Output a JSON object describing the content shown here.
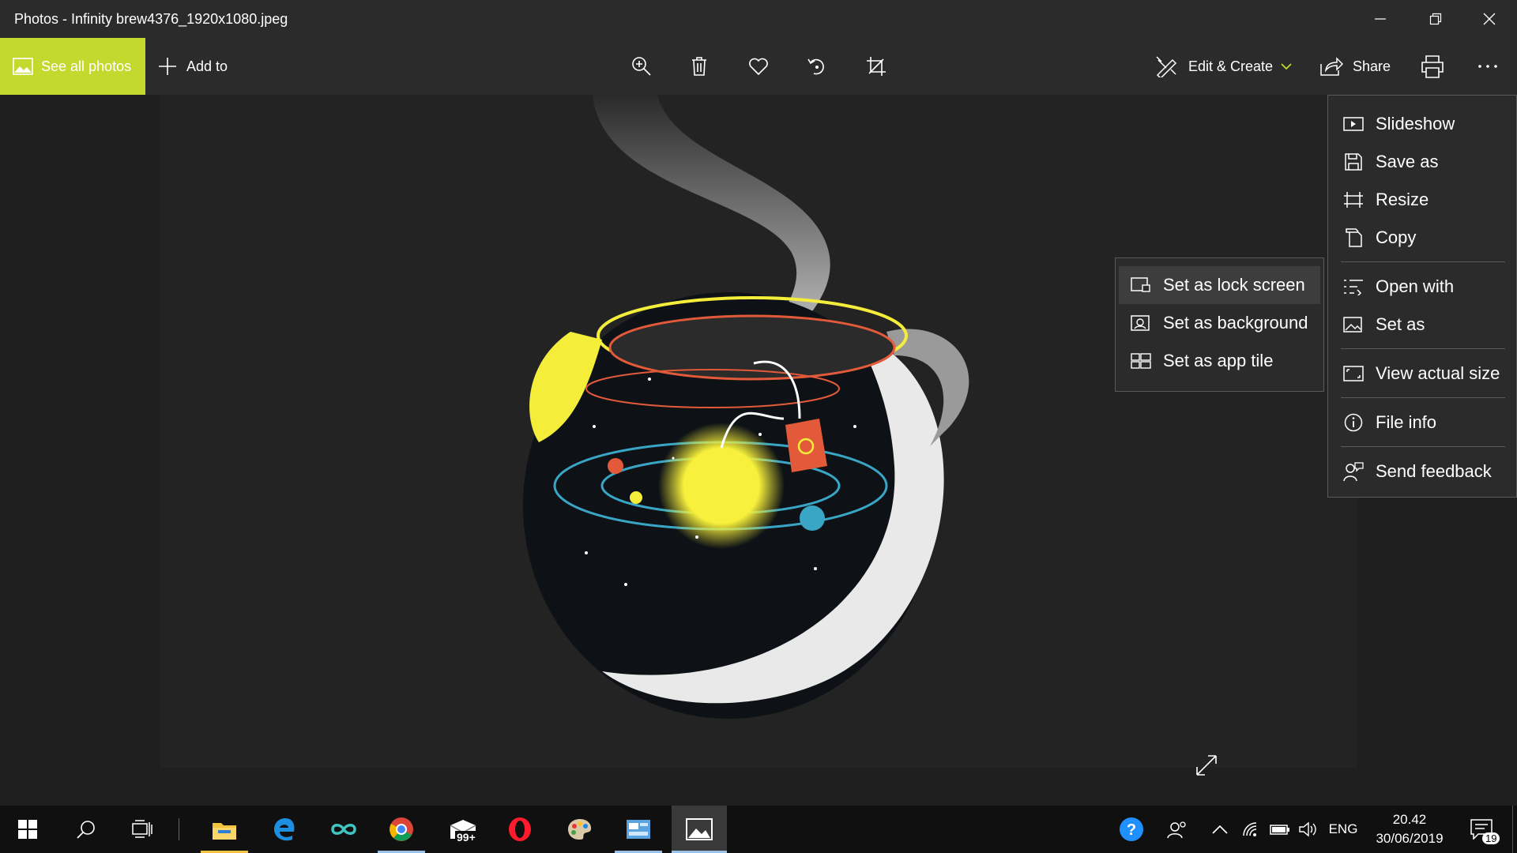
{
  "window": {
    "title": "Photos - Infinity brew4376_1920x1080.jpeg",
    "controls": [
      "minimize-icon",
      "restore-icon",
      "close-icon"
    ]
  },
  "toolbar": {
    "see_all_label": "See all photos",
    "add_to_label": "Add to",
    "tools": [
      "zoom-in-icon",
      "delete-icon",
      "favorite-icon",
      "rotate-icon",
      "crop-icon"
    ],
    "edit_create_label": "Edit & Create",
    "share_label": "Share",
    "accent_color": "#c4d82d"
  },
  "more_menu": {
    "items": [
      {
        "label": "Slideshow",
        "icon": "slideshow-icon"
      },
      {
        "label": "Save as",
        "icon": "save-icon"
      },
      {
        "label": "Resize",
        "icon": "resize-icon"
      },
      {
        "label": "Copy",
        "icon": "copy-icon"
      },
      {
        "label": "Open with",
        "icon": "open-with-icon"
      },
      {
        "label": "Set as",
        "icon": "set-as-icon"
      },
      {
        "label": "View actual size",
        "icon": "actual-size-icon"
      },
      {
        "label": "File info",
        "icon": "info-icon"
      },
      {
        "label": "Send feedback",
        "icon": "feedback-icon"
      }
    ]
  },
  "set_as_submenu": {
    "items": [
      {
        "label": "Set as lock screen",
        "icon": "lock-screen-icon",
        "highlighted": true
      },
      {
        "label": "Set as background",
        "icon": "background-icon"
      },
      {
        "label": "Set as app tile",
        "icon": "app-tile-icon"
      }
    ]
  },
  "taskbar": {
    "apps": [
      "file-explorer-icon",
      "edge-icon",
      "infinity-app-icon",
      "chrome-icon",
      "mail-icon",
      "opera-icon",
      "paint-icon",
      "control-panel-icon",
      "photos-icon"
    ],
    "mail_badge": "99+",
    "language": "ENG",
    "time": "20.42",
    "date": "30/06/2019",
    "notification_count": "19"
  }
}
